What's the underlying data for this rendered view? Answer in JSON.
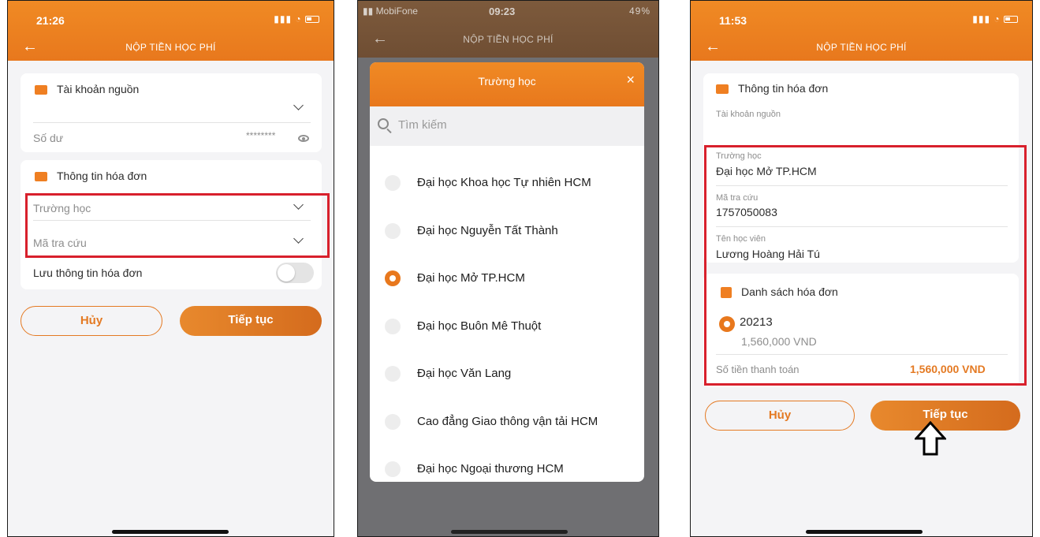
{
  "screen1": {
    "status_time": "21:26",
    "title": "NỘP TIỀN HỌC PHÍ",
    "source_account_label": "Tài khoản nguồn",
    "balance_label": "Số dư",
    "balance_value": "********",
    "invoice_info_label": "Thông tin hóa đơn",
    "school_placeholder": "Trường học",
    "lookup_placeholder": "Mã tra cứu",
    "save_invoice_label": "Lưu thông tin hóa đơn",
    "cancel_label": "Hủy",
    "continue_label": "Tiếp tục"
  },
  "screen2": {
    "carrier": "MobiFone",
    "status_time": "09:23",
    "battery": "49%",
    "title": "NỘP TIỀN HỌC PHÍ",
    "modal_title": "Trường học",
    "close_glyph": "×",
    "search_placeholder": "Tìm kiếm",
    "options": [
      {
        "label": "Đại học Khoa học Tự nhiên HCM",
        "selected": false
      },
      {
        "label": "Đại học Nguyễn Tất Thành",
        "selected": false
      },
      {
        "label": "Đại học Mở TP.HCM",
        "selected": true
      },
      {
        "label": "Đại học Buôn Mê Thuột",
        "selected": false
      },
      {
        "label": "Đại học Văn Lang",
        "selected": false
      },
      {
        "label": "Cao đẳng Giao thông vận tải HCM",
        "selected": false
      },
      {
        "label": "Đại học Ngoại thương HCM",
        "selected": false
      }
    ]
  },
  "screen3": {
    "status_time": "11:53",
    "title": "NỘP TIỀN HỌC PHÍ",
    "invoice_info_label": "Thông tin hóa đơn",
    "source_account_label": "Tài khoản nguồn",
    "school_label": "Trường học",
    "school_value": "Đại học Mở TP.HCM",
    "lookup_label": "Mã tra cứu",
    "lookup_value": "1757050083",
    "student_label": "Tên học viên",
    "student_value": "Lương Hoàng Hải Tú",
    "invoice_list_label": "Danh sách hóa đơn",
    "invoice_code": "20213",
    "invoice_amount": "1,560,000 VND",
    "pay_amount_label": "Số tiền thanh toán",
    "pay_amount_value": "1,560,000 VND",
    "cancel_label": "Hủy",
    "continue_label": "Tiếp tục"
  },
  "colors": {
    "accent": "#E8781D",
    "highlight": "#D8202C"
  }
}
